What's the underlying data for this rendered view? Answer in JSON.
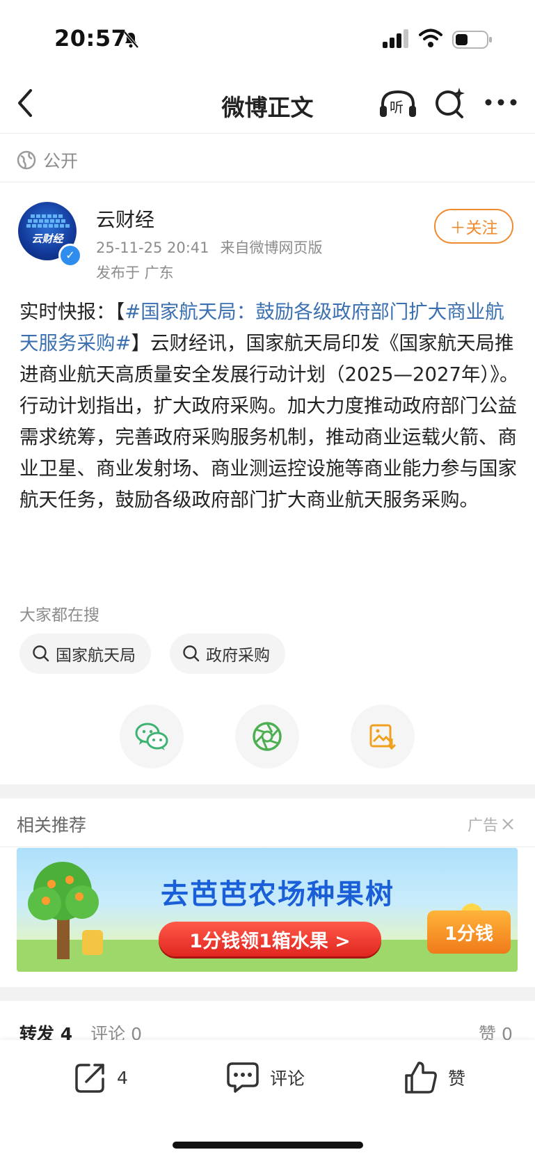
{
  "status_bar": {
    "time": "20:57"
  },
  "nav": {
    "title": "微博正文",
    "listen_label": "听"
  },
  "visibility": {
    "label": "公开"
  },
  "author": {
    "name": "云财经",
    "time": "25-11-25 20:41",
    "source": "来自微博网页版",
    "location": "发布于 广东",
    "follow_label": "＋关注",
    "avatar_text": "云财经"
  },
  "post": {
    "prefix": "实时快报：",
    "bracket_open": "【",
    "topic": "#国家航天局：鼓励各级政府部门扩大商业航天服务采购#",
    "bracket_close": "】",
    "body": "云财经讯，国家航天局印发《国家航天局推进商业航天高质量安全发展行动计划（2025—2027年）》。行动计划指出，扩大政府采购。加大力度推动政府部门公益需求统筹，完善政府采购服务机制，推动商业运载火箭、商业卫星、商业发射场、商业测运控设施等商业能力参与国家航天任务，鼓励各级政府部门扩大商业航天服务采购。"
  },
  "search_suggest": {
    "label": "大家都在搜",
    "chips": [
      "国家航天局",
      "政府采购"
    ]
  },
  "share": {
    "icons": [
      "wechat-icon",
      "moments-icon",
      "save-image-icon"
    ]
  },
  "related": {
    "title": "相关推荐",
    "ad_label": "广告",
    "banner": {
      "headline": "去芭芭农场种果树",
      "cta": "1分钱领1箱水果 >",
      "badge": "1分钱"
    }
  },
  "stats": {
    "repost_label": "转发",
    "repost_count": "4",
    "comment_label": "评论",
    "comment_count": "0",
    "like_label": "赞",
    "like_count": "0"
  },
  "actions": {
    "repost_count": "4",
    "comment_label": "评论",
    "like_label": "赞"
  },
  "colors": {
    "accent_orange": "#f08a2e",
    "topic_blue": "#3a6fb0",
    "wechat_green": "#3cb371",
    "save_orange": "#f0a020"
  }
}
